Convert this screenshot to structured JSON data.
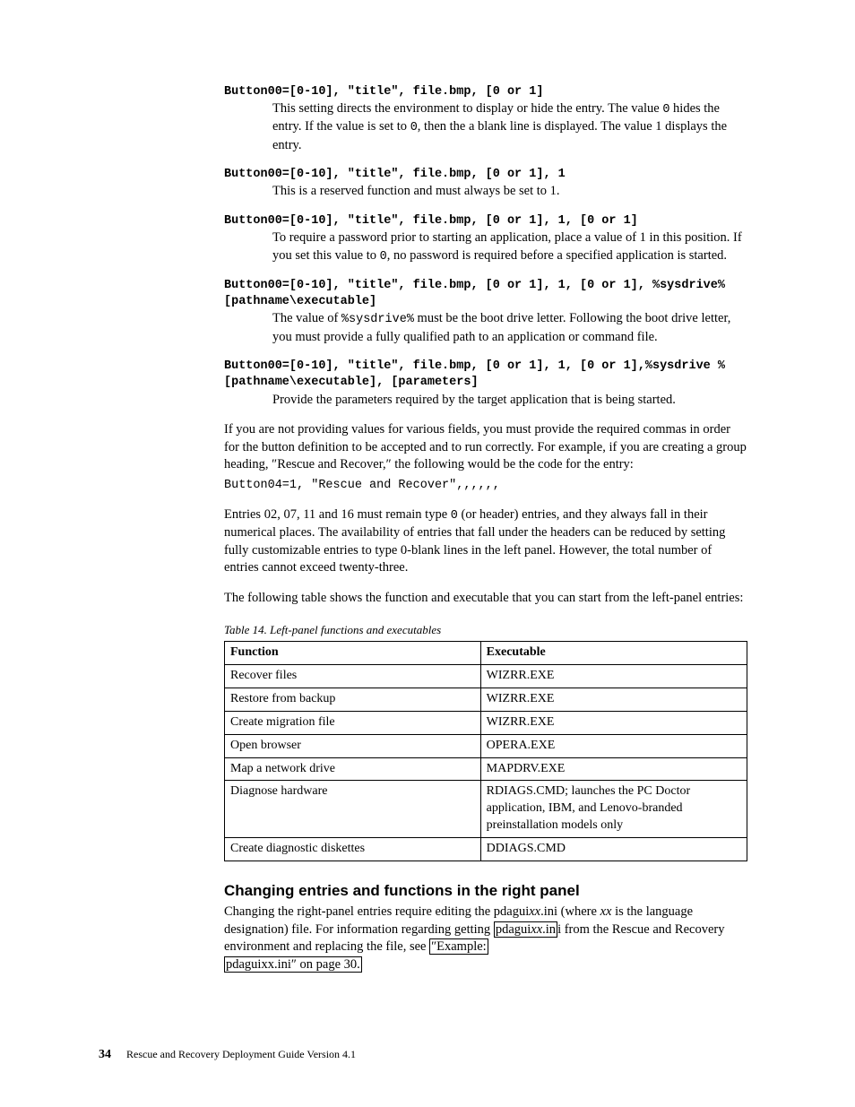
{
  "entries": [
    {
      "code": "Button00=[0-10], \"title\", file.bmp, [0 or 1]",
      "body_pre": "This setting directs the environment to display or hide the entry. The value ",
      "body_code1": "0",
      "body_mid1": " hides the entry. If the value is set to ",
      "body_code2": "0",
      "body_mid2": ", then the a blank line is displayed. The value 1 displays the entry."
    },
    {
      "code": "Button00=[0-10], \"title\", file.bmp, [0 or 1], 1",
      "body_pre": "This is a reserved function and must always be set to 1."
    },
    {
      "code": "Button00=[0-10], \"title\", file.bmp, [0 or 1], 1, [0 or 1]",
      "body_pre": "To require a password prior to starting an application, place a value of 1 in this position. If you set this value to ",
      "body_code1": "0",
      "body_mid1": ", no password is required before a specified application is started."
    },
    {
      "code": "Button00=[0-10], \"title\", file.bmp, [0 or 1], 1, [0 or 1], %sysdrive%[pathname\\executable]",
      "body_pre": "The value of ",
      "body_code1": "%sysdrive%",
      "body_mid1": " must be the boot drive letter. Following the boot drive letter, you must provide a fully qualified path to an application or command file."
    },
    {
      "code": "Button00=[0-10], \"title\", file.bmp, [0 or 1], 1, [0 or 1],%sysdrive %[pathname\\executable], [parameters]",
      "body_pre": "Provide the parameters required by the target application that is being started."
    }
  ],
  "para1_pre": "If you are not providing values for various fields, you must provide the required commas in order for the button definition to be accepted and to run correctly. For example, if you are creating a group heading, ″Rescue and Recover,″ the following would be the code for the entry:",
  "para1_code": "Button04=1, \"Rescue and Recover\",,,,,,",
  "para2_pre": "Entries 02, 07, 11 and 16 must remain type ",
  "para2_code": "0",
  "para2_post": " (or header) entries, and they always fall in their numerical places. The availability of entries that fall under the headers can be reduced by setting fully customizable entries to type 0-blank lines in the left panel. However, the total number of entries cannot exceed twenty-three.",
  "para3": "The following table shows the function and executable that you can start from the left-panel entries:",
  "table_caption": "Table 14. Left-panel functions and executables",
  "table": {
    "headers": [
      "Function",
      "Executable"
    ],
    "rows": [
      [
        "Recover files",
        "WIZRR.EXE"
      ],
      [
        "Restore from backup",
        "WIZRR.EXE"
      ],
      [
        "Create migration file",
        "WIZRR.EXE"
      ],
      [
        "Open browser",
        "OPERA.EXE"
      ],
      [
        "Map a network drive",
        "MAPDRV.EXE"
      ],
      [
        "Diagnose hardware",
        "RDIAGS.CMD; launches the PC Doctor application, IBM, and Lenovo-branded preinstallation models only"
      ],
      [
        "Create diagnostic diskettes",
        "DDIAGS.CMD"
      ]
    ]
  },
  "section_heading": "Changing entries and functions in the right panel",
  "section_body_1": "Changing the right-panel entries require editing the pdagui",
  "section_body_ital1": "xx",
  "section_body_2": ".ini (where ",
  "section_body_ital2": "xx",
  "section_body_3": " is the language designation) file. For information regarding getting ",
  "section_link1_pre": "pdagui",
  "section_link1_ital": "xx",
  "section_link1_post": ".in",
  "section_body_4": "i from the Rescue and Recovery environment and replacing the file, see ",
  "section_link2a": "″Example:",
  "section_link2b": "pdaguixx.ini″ on page 30.",
  "footer": {
    "pagenum": "34",
    "title": "Rescue and Recovery Deployment Guide Version 4.1"
  }
}
